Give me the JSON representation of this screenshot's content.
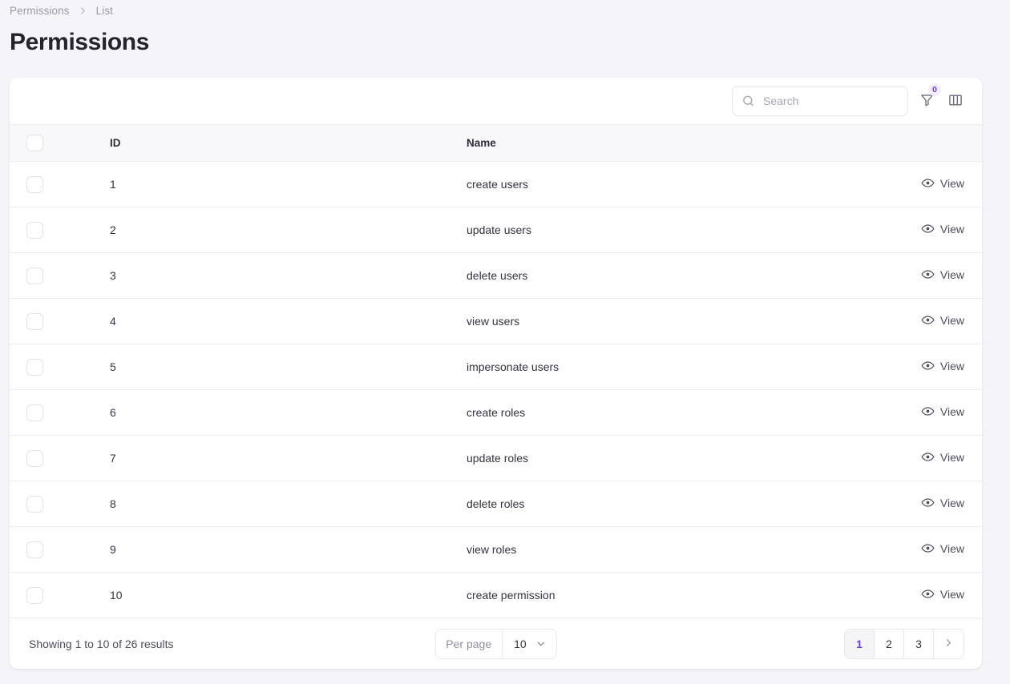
{
  "breadcrumb": {
    "items": [
      {
        "label": "Permissions"
      },
      {
        "label": "List"
      }
    ],
    "separator_icon": "chevron-right-icon"
  },
  "page_title": "Permissions",
  "toolbar": {
    "search": {
      "placeholder": "Search",
      "value": "",
      "icon": "search-icon"
    },
    "filter": {
      "icon": "filter-icon",
      "badge_count": "0",
      "badge_color": "#6d3df0"
    },
    "columns": {
      "icon": "columns-icon"
    }
  },
  "table": {
    "columns": [
      {
        "key": "id",
        "label": "ID"
      },
      {
        "key": "name",
        "label": "Name"
      }
    ],
    "action_label": "View",
    "action_icon": "eye-icon",
    "rows": [
      {
        "id": "1",
        "name": "create users"
      },
      {
        "id": "2",
        "name": "update users"
      },
      {
        "id": "3",
        "name": "delete users"
      },
      {
        "id": "4",
        "name": "view users"
      },
      {
        "id": "5",
        "name": "impersonate users"
      },
      {
        "id": "6",
        "name": "create roles"
      },
      {
        "id": "7",
        "name": "update roles"
      },
      {
        "id": "8",
        "name": "delete roles"
      },
      {
        "id": "9",
        "name": "view roles"
      },
      {
        "id": "10",
        "name": "create permission"
      }
    ]
  },
  "footer": {
    "showing_text": "Showing 1 to 10 of 26 results",
    "per_page": {
      "label": "Per page",
      "value": "10",
      "chevron_icon": "chevron-down-icon"
    },
    "pagination": {
      "pages": [
        "1",
        "2",
        "3"
      ],
      "active_page": "1",
      "next_icon": "chevron-right-icon"
    }
  }
}
